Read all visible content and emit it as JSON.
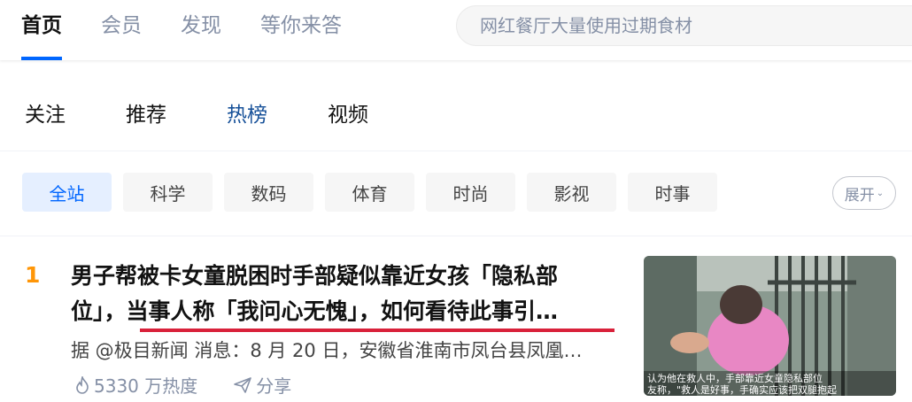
{
  "top_nav": {
    "tabs": [
      "首页",
      "会员",
      "发现",
      "等你来答"
    ]
  },
  "search": {
    "placeholder": "网红餐厅大量使用过期食材"
  },
  "sub_nav": {
    "tabs": [
      "关注",
      "推荐",
      "热榜",
      "视频"
    ]
  },
  "categories": {
    "chips": [
      "全站",
      "科学",
      "数码",
      "体育",
      "时尚",
      "影视",
      "时事"
    ],
    "expand_label": "展开"
  },
  "hot_item": {
    "rank": "1",
    "title_line1": "男子帮被卡女童脱困时手部疑似靠近女孩「隐私部",
    "title_line2": "位」，当事人称「我问心无愧」，如何看待此事引…",
    "excerpt": "据 @极目新闻 消息：8 月 20 日，安徽省淮南市凤台县凤凰…",
    "heat": "5330 万热度",
    "share": "分享",
    "thumbnail_caption_1": "认为他在救人中，手部靠近女童隐私部位",
    "thumbnail_caption_2": "友称，\"救人是好事，手确实应该把双腿抱起"
  },
  "colors": {
    "accent": "#0066ff",
    "rank": "#ff9607",
    "underline": "#d9213a",
    "muted": "#8590a6"
  }
}
